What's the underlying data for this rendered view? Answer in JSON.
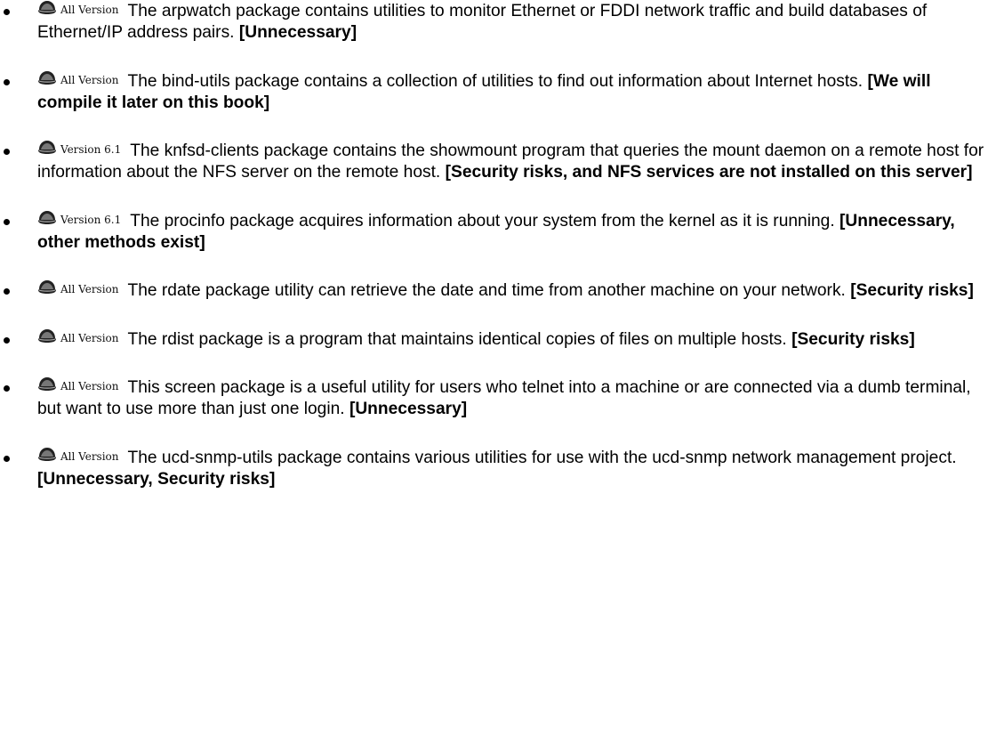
{
  "items": [
    {
      "version": "All Version",
      "icon": "redhat-hat-icon",
      "description": "The arpwatch package contains utilities to monitor Ethernet or FDDI network traffic and build databases of Ethernet/IP address pairs.",
      "reason": "[Unnecessary]"
    },
    {
      "version": "All Version",
      "icon": "redhat-hat-icon",
      "description": "The bind-utils package contains a collection of utilities to find out information about Internet hosts.",
      "reason": "[We will compile it later on this book]"
    },
    {
      "version": "Version 6.1",
      "icon": "redhat-hat-icon",
      "description": "The knfsd-clients package contains the showmount program that queries the mount daemon on a remote host for information about the NFS server on the remote host.",
      "reason": "[Security risks, and NFS services are not installed on this server]"
    },
    {
      "version": "Version 6.1",
      "icon": "redhat-hat-icon",
      "description": "The procinfo package acquires information about your system from the kernel as it is running.",
      "reason": "[Unnecessary, other methods exist]"
    },
    {
      "version": "All Version",
      "icon": "redhat-hat-icon",
      "description": "The rdate package utility can retrieve the date and time from another machine on your network.",
      "reason": "[Security risks]"
    },
    {
      "version": "All Version",
      "icon": "redhat-hat-icon",
      "description": "The rdist package is a program that maintains identical copies of files on multiple hosts.",
      "reason": "[Security risks]"
    },
    {
      "version": "All Version",
      "icon": "redhat-hat-icon",
      "description": "This screen package is a useful utility for users who telnet into a machine or are connected via a dumb terminal, but want to use more than just one login.",
      "reason": "[Unnecessary]"
    },
    {
      "version": "All Version",
      "icon": "redhat-hat-icon",
      "description": "The ucd-snmp-utils package contains various utilities for use with the ucd-snmp network management project.",
      "reason": "[Unnecessary, Security risks]"
    }
  ]
}
